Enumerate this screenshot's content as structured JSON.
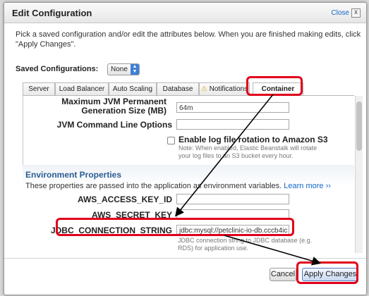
{
  "dialog": {
    "title": "Edit Configuration",
    "close_label": "Close",
    "close_x": "x",
    "intro": "Pick a saved configuration and/or edit the attributes below. When you are finished making edits, click \"Apply Changes\"."
  },
  "saved_configurations": {
    "label": "Saved Configurations:",
    "value": "None"
  },
  "tabs": [
    {
      "label": "Server"
    },
    {
      "label": "Load Balancer"
    },
    {
      "label": "Auto Scaling"
    },
    {
      "label": "Database"
    },
    {
      "label": "Notifications",
      "icon": "warning-icon"
    },
    {
      "label": "Container",
      "active": true
    }
  ],
  "container": {
    "permgen_label": "Maximum JVM Permanent Generation Size (MB)",
    "permgen_value": "64m",
    "jvm_options_label": "JVM Command Line Options",
    "jvm_options_value": "",
    "log_rotation_label": "Enable log file rotation to Amazon S3",
    "log_rotation_note_1": "Note: When enabled, Elastic Beanstalk will rotate",
    "log_rotation_note_2": "your log files to an S3 bucket every hour."
  },
  "environment": {
    "title": "Environment Properties",
    "description": "These properties are passed into the application as environment variables.",
    "learn_more": "Learn more ››",
    "fields": [
      {
        "label": "AWS_ACCESS_KEY_ID",
        "value": ""
      },
      {
        "label": "AWS_SECRET_KEY",
        "value": ""
      },
      {
        "label": "JDBC_CONNECTION_STRING",
        "value": "jdbc:mysql://petclinic-io-db.cccb4ic"
      }
    ],
    "jdbc_note_1": "JDBC connection string to JDBC database (e.g.",
    "jdbc_note_2": "RDS) for application use."
  },
  "buttons": {
    "cancel": "Cancel",
    "apply": "Apply Changes"
  },
  "colors": {
    "highlight": "#e0001b",
    "link": "#1166cc",
    "section_title": "#2a5c92"
  }
}
